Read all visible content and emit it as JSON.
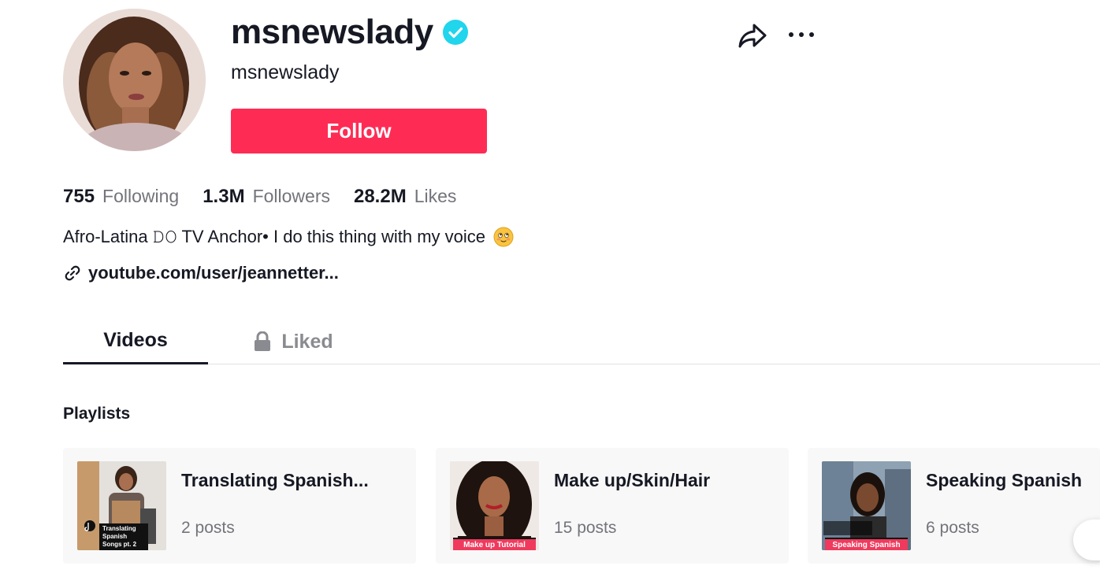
{
  "profile": {
    "username": "msnewslady",
    "nickname": "msnewslady",
    "verified": true,
    "follow_label": "Follow"
  },
  "stats": [
    {
      "value": "755",
      "label": "Following"
    },
    {
      "value": "1.3M",
      "label": "Followers"
    },
    {
      "value": "28.2M",
      "label": "Likes"
    }
  ],
  "bio": {
    "text": "Afro-Latina 𝙳𝙾 TV Anchor• I do this thing with my voice",
    "emoji": "smiling-face-emoji"
  },
  "link": {
    "text": "youtube.com/user/jeannetter..."
  },
  "tabs": [
    {
      "label": "Videos",
      "active": true
    },
    {
      "label": "Liked",
      "active": false,
      "locked": true
    }
  ],
  "playlists": {
    "title": "Playlists",
    "items": [
      {
        "title": "Translating Spanish...",
        "count": "2 posts",
        "thumb_caption": "Translating Spanish Songs pt. 2"
      },
      {
        "title": "Make up/Skin/Hair",
        "count": "15 posts",
        "thumb_caption": "Make up Tutorial"
      },
      {
        "title": "Speaking Spanish",
        "count": "6 posts",
        "thumb_caption": "Speaking Spanish"
      }
    ]
  },
  "colors": {
    "accent": "#fe2c55",
    "verified": "#20d5ec",
    "text_primary": "#161823",
    "text_secondary": "#73747b"
  },
  "icons": {
    "share": "share-arrow-icon",
    "more": "more-dots-icon",
    "link": "link-icon",
    "lock": "lock-icon",
    "verified": "verified-badge-icon"
  }
}
